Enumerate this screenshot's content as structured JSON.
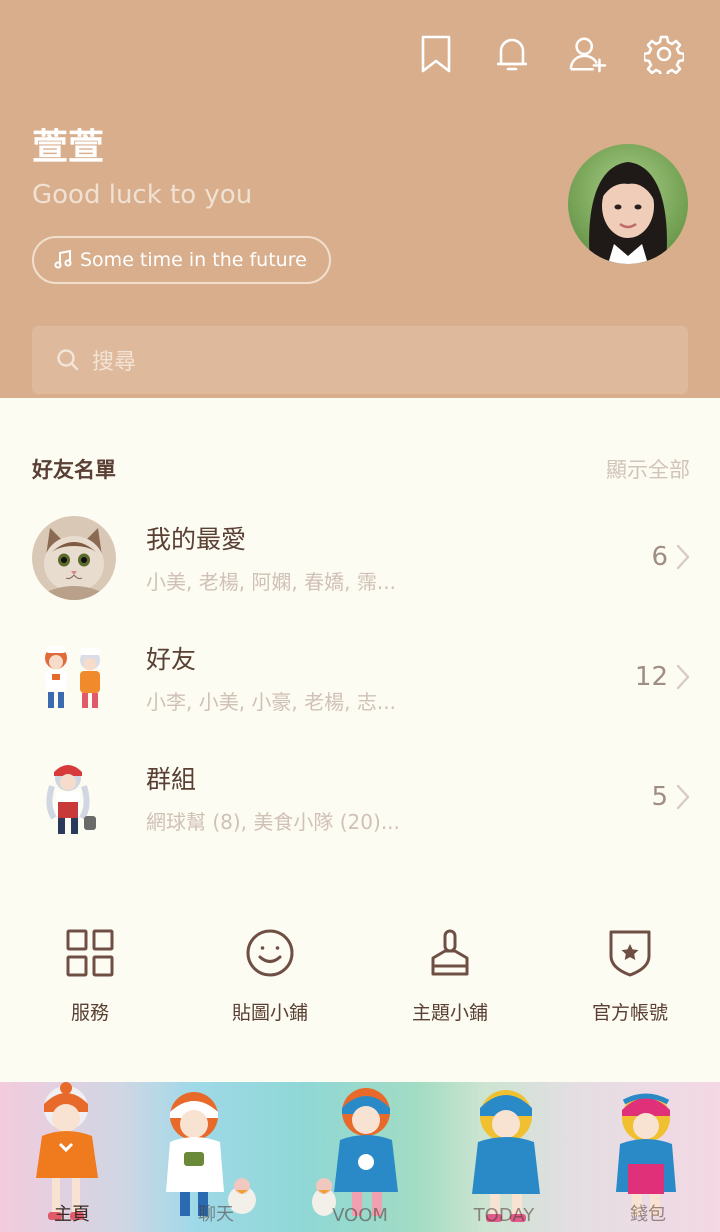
{
  "header": {
    "profile_name": "萱萱",
    "status_message": "Good luck to you",
    "music": "Some time in the future",
    "icons": [
      "bookmark-icon",
      "bell-icon",
      "add-friend-icon",
      "gear-icon"
    ],
    "search_placeholder": "搜尋"
  },
  "friends": {
    "section_title": "好友名單",
    "show_all": "顯示全部",
    "rows": [
      {
        "title": "我的最愛",
        "subtitle": "小美, 老楊, 阿嫻, 春嬌, 霈...",
        "count": "6"
      },
      {
        "title": "好友",
        "subtitle": "小李, 小美, 小豪, 老楊, 志...",
        "count": "12"
      },
      {
        "title": "群組",
        "subtitle": "網球幫 (8), 美食小隊 (20)...",
        "count": "5"
      }
    ]
  },
  "quick_actions": [
    {
      "label": "服務",
      "icon": "grid-icon"
    },
    {
      "label": "貼圖小鋪",
      "icon": "smiley-icon"
    },
    {
      "label": "主題小鋪",
      "icon": "brush-icon"
    },
    {
      "label": "官方帳號",
      "icon": "shield-star-icon"
    }
  ],
  "bottom_nav": [
    {
      "label": "主頁",
      "active": true
    },
    {
      "label": "聊天",
      "active": false
    },
    {
      "label": "VOOM",
      "active": false
    },
    {
      "label": "TODAY",
      "active": false
    },
    {
      "label": "錢包",
      "active": false
    }
  ],
  "colors": {
    "header_bg": "#d8ae8c",
    "body_bg": "#fdfcf2",
    "primary_text": "#5a4034",
    "muted_text": "#d0c1b6"
  }
}
